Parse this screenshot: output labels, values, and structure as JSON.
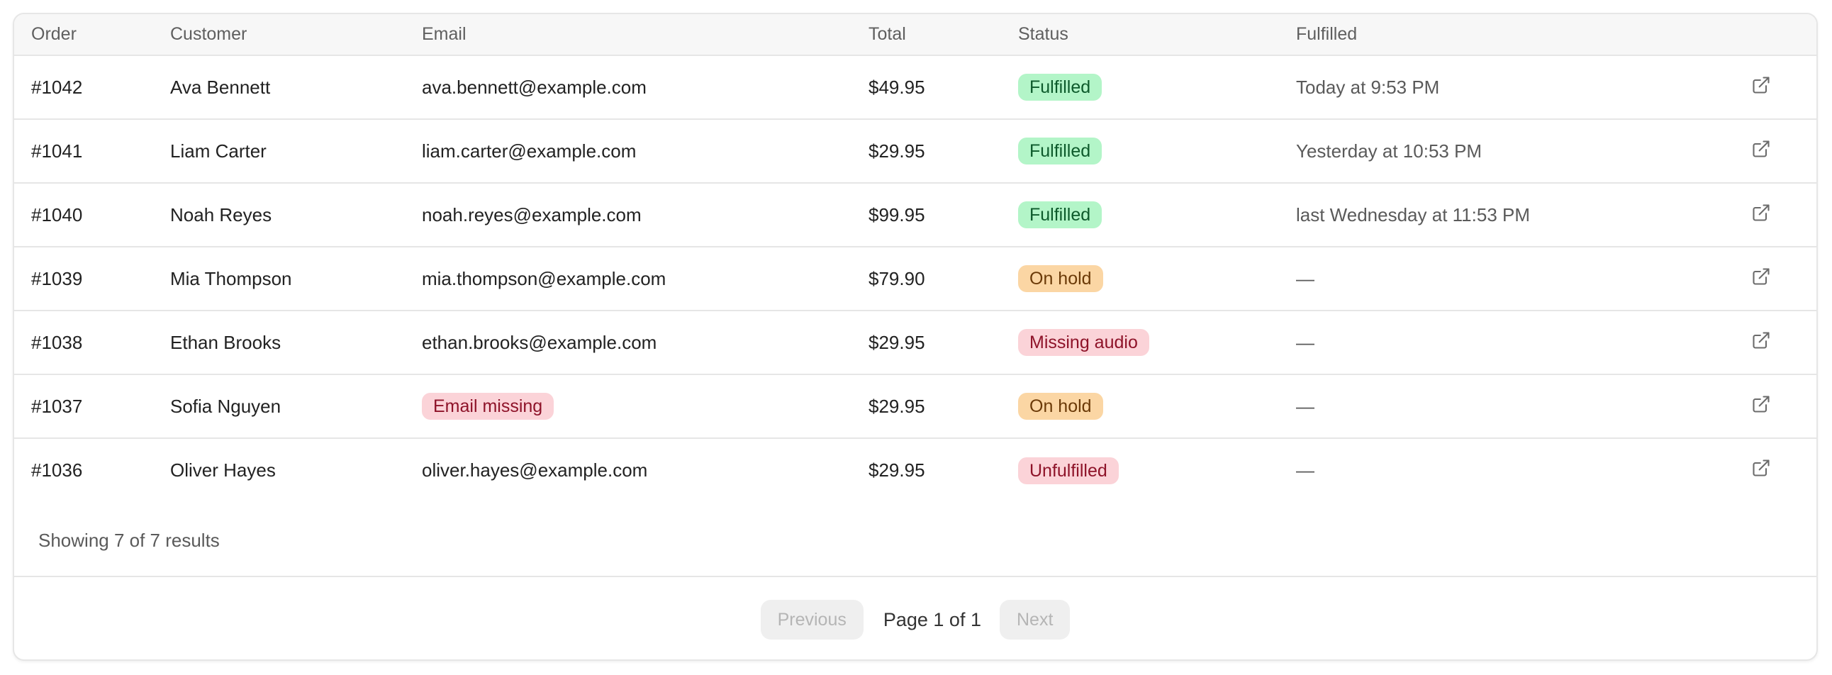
{
  "table": {
    "columns": {
      "order": "Order",
      "customer": "Customer",
      "email": "Email",
      "total": "Total",
      "status": "Status",
      "fulfilled": "Fulfilled"
    },
    "rows": [
      {
        "order": "#1042",
        "customer": "Ava Bennett",
        "email": "ava.bennett@example.com",
        "total": "$49.95",
        "status": "Fulfilled",
        "fulfilled": "Today at 9:53 PM"
      },
      {
        "order": "#1041",
        "customer": "Liam Carter",
        "email": "liam.carter@example.com",
        "total": "$29.95",
        "status": "Fulfilled",
        "fulfilled": "Yesterday at 10:53 PM"
      },
      {
        "order": "#1040",
        "customer": "Noah Reyes",
        "email": "noah.reyes@example.com",
        "total": "$99.95",
        "status": "Fulfilled",
        "fulfilled": "last Wednesday at 11:53 PM"
      },
      {
        "order": "#1039",
        "customer": "Mia Thompson",
        "email": "mia.thompson@example.com",
        "total": "$79.90",
        "status": "On hold",
        "fulfilled": "—"
      },
      {
        "order": "#1038",
        "customer": "Ethan Brooks",
        "email": "ethan.brooks@example.com",
        "total": "$29.95",
        "status": "Missing audio",
        "fulfilled": "—"
      },
      {
        "order": "#1037",
        "customer": "Sofia Nguyen",
        "email": "Email missing",
        "total": "$29.95",
        "status": "On hold",
        "fulfilled": "—"
      },
      {
        "order": "#1036",
        "customer": "Oliver Hayes",
        "email": "oliver.hayes@example.com",
        "total": "$29.95",
        "status": "Unfulfilled",
        "fulfilled": "—"
      }
    ]
  },
  "status_colors": {
    "fulfilled": "#b3f5c8",
    "on_hold": "#fbd6a4",
    "missing": "#fbd3d8"
  },
  "row_action_icon": "external-link-icon",
  "summary": "Showing 7 of 7 results",
  "pagination": {
    "previous_label": "Previous",
    "page_label": "Page 1 of 1",
    "next_label": "Next"
  }
}
